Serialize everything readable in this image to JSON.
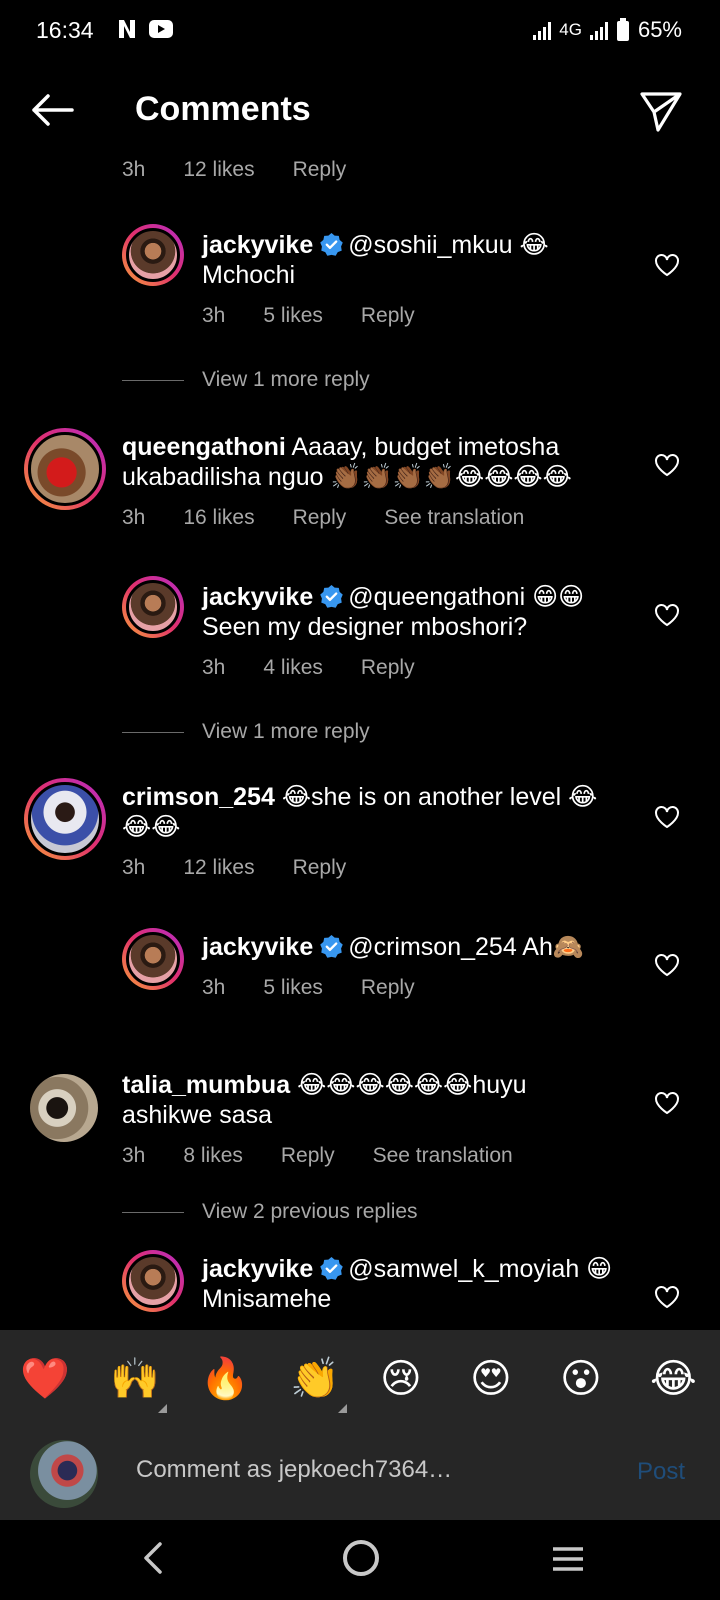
{
  "status_bar": {
    "time": "16:34",
    "network": "4G",
    "battery": "65%"
  },
  "header": {
    "title": "Comments"
  },
  "partial_top": {
    "time": "3h",
    "likes": "12 likes",
    "reply": "Reply"
  },
  "comments": [
    {
      "user": "jackyvike",
      "verified": true,
      "line1": "@soshii_mkuu 😂",
      "line2": "Mchochi",
      "time": "3h",
      "likes": "5 likes",
      "reply": "Reply"
    },
    {
      "view_more": "View 1 more reply"
    },
    {
      "user": "queengathoni",
      "verified": false,
      "line1": "Aaaay, budget imetosha",
      "line2": "ukabadilisha nguo 👏🏾👏🏾👏🏾👏🏾😂😂😂😂",
      "time": "3h",
      "likes": "16 likes",
      "reply": "Reply",
      "translate": "See translation"
    },
    {
      "user": "jackyvike",
      "verified": true,
      "line1": "@queengathoni 😁😁",
      "line2": "Seen my designer mboshori?",
      "time": "3h",
      "likes": "4 likes",
      "reply": "Reply"
    },
    {
      "view_more": "View 1 more reply"
    },
    {
      "user": "crimson_254",
      "verified": false,
      "line1": "😂she is on another level 😂",
      "line2": "😂😂",
      "time": "3h",
      "likes": "12 likes",
      "reply": "Reply"
    },
    {
      "user": "jackyvike",
      "verified": true,
      "line1": "@crimson_254 Ah🙈",
      "time": "3h",
      "likes": "5 likes",
      "reply": "Reply"
    },
    {
      "user": "talia_mumbua",
      "verified": false,
      "line1": "😂😂😂😂😂😂huyu",
      "line2": "ashikwe sasa",
      "time": "3h",
      "likes": "8 likes",
      "reply": "Reply",
      "translate": "See translation"
    },
    {
      "view_more": "View 2 previous replies"
    },
    {
      "user": "jackyvike",
      "verified": true,
      "line1": "@samwel_k_moyiah 😁",
      "line2": "Mnisamehe"
    }
  ],
  "emoji_bar": [
    "❤️",
    "🙌",
    "🔥",
    "👏",
    "😢",
    "😍",
    "😮",
    "😂"
  ],
  "composer": {
    "placeholder": "Comment as jepkoech7364…",
    "post_label": "Post"
  },
  "colors": {
    "background": "#000000",
    "muted_text": "#a8a8a8",
    "verified_blue": "#3897f0",
    "panel": "#262626",
    "post_disabled": "#1f4d7a"
  }
}
